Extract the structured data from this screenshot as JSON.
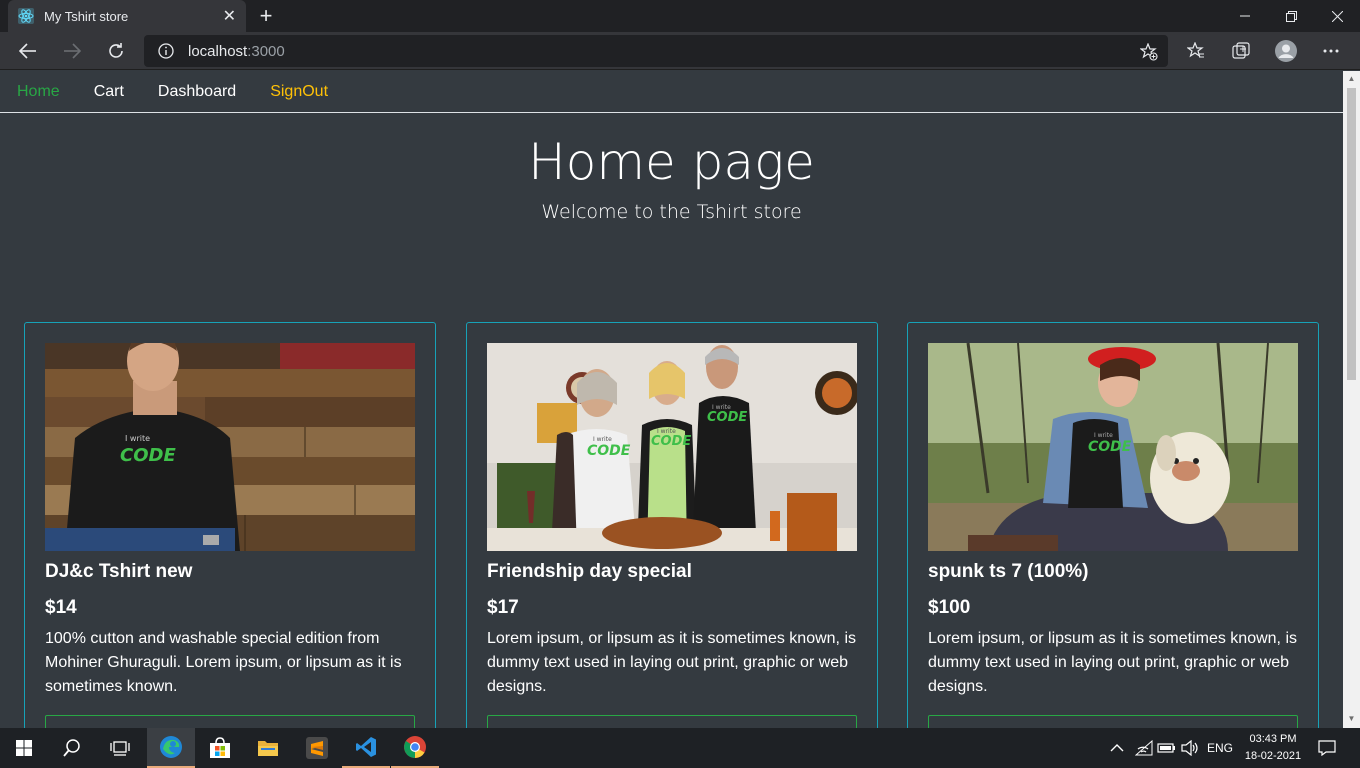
{
  "browser": {
    "tab_title": "My Tshirt store",
    "url_host": "localhost",
    "url_port": ":3000"
  },
  "nav": {
    "home": "Home",
    "cart": "Cart",
    "dashboard": "Dashboard",
    "signout": "SignOut"
  },
  "hero": {
    "title": "Home page",
    "subtitle": "Welcome to the Tshirt store"
  },
  "products": [
    {
      "title": "DJ&c Tshirt new",
      "price": "$14",
      "description": "100% cutton and washable special edition from Mohiner Ghuraguli. Lorem ipsum, or lipsum as it is sometimes known."
    },
    {
      "title": "Friendship day special",
      "price": "$17",
      "description": "Lorem ipsum, or lipsum as it is sometimes known, is dummy text used in laying out print, graphic or web designs."
    },
    {
      "title": "spunk ts 7 (100%)",
      "price": "$100",
      "description": "Lorem ipsum, or lipsum as it is sometimes known, is dummy text used in laying out print, graphic or web designs."
    }
  ],
  "taskbar": {
    "language": "ENG",
    "time": "03:43 PM",
    "date": "18-02-2021"
  },
  "colors": {
    "page_bg": "#343a40",
    "active_nav": "#28a745",
    "signout": "#ffc107",
    "card_border": "#17a2b8",
    "button_border": "#28a745"
  }
}
